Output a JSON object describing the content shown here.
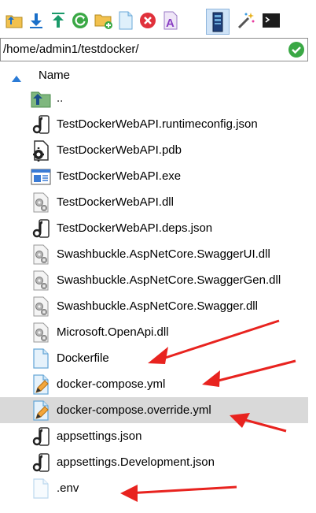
{
  "toolbar": {
    "buttons": [
      {
        "name": "parent-folder-icon"
      },
      {
        "name": "download-icon"
      },
      {
        "name": "upload-icon"
      },
      {
        "name": "refresh-icon"
      },
      {
        "name": "new-folder-icon"
      },
      {
        "name": "new-file-icon"
      },
      {
        "name": "delete-icon"
      },
      {
        "name": "rename-icon"
      },
      {
        "name": "properties-icon"
      },
      {
        "name": "magic-wand-icon"
      },
      {
        "name": "terminal-icon"
      }
    ]
  },
  "path": {
    "value": "/home/admin1/testdocker/"
  },
  "header": {
    "name_label": "Name"
  },
  "files": [
    {
      "name": "..",
      "icon": "parent-dir-icon"
    },
    {
      "name": "TestDockerWebAPI.runtimeconfig.json",
      "icon": "json-file-icon"
    },
    {
      "name": "TestDockerWebAPI.pdb",
      "icon": "pdb-file-icon"
    },
    {
      "name": "TestDockerWebAPI.exe",
      "icon": "exe-file-icon"
    },
    {
      "name": "TestDockerWebAPI.dll",
      "icon": "dll-file-icon"
    },
    {
      "name": "TestDockerWebAPI.deps.json",
      "icon": "json-file-icon"
    },
    {
      "name": "Swashbuckle.AspNetCore.SwaggerUI.dll",
      "icon": "dll-file-icon"
    },
    {
      "name": "Swashbuckle.AspNetCore.SwaggerGen.dll",
      "icon": "dll-file-icon"
    },
    {
      "name": "Swashbuckle.AspNetCore.Swagger.dll",
      "icon": "dll-file-icon"
    },
    {
      "name": "Microsoft.OpenApi.dll",
      "icon": "dll-file-icon"
    },
    {
      "name": "Dockerfile",
      "icon": "blank-file-icon"
    },
    {
      "name": "docker-compose.yml",
      "icon": "text-edit-file-icon"
    },
    {
      "name": "docker-compose.override.yml",
      "icon": "text-edit-file-icon"
    },
    {
      "name": "appsettings.json",
      "icon": "json-file-icon"
    },
    {
      "name": "appsettings.Development.json",
      "icon": "json-file-icon"
    },
    {
      "name": ".env",
      "icon": "empty-file-icon"
    }
  ],
  "selected_index": 12,
  "colors": {
    "arrow": "#e8231f",
    "accent_green": "#3aa845",
    "selection": "#d9d9d9"
  }
}
